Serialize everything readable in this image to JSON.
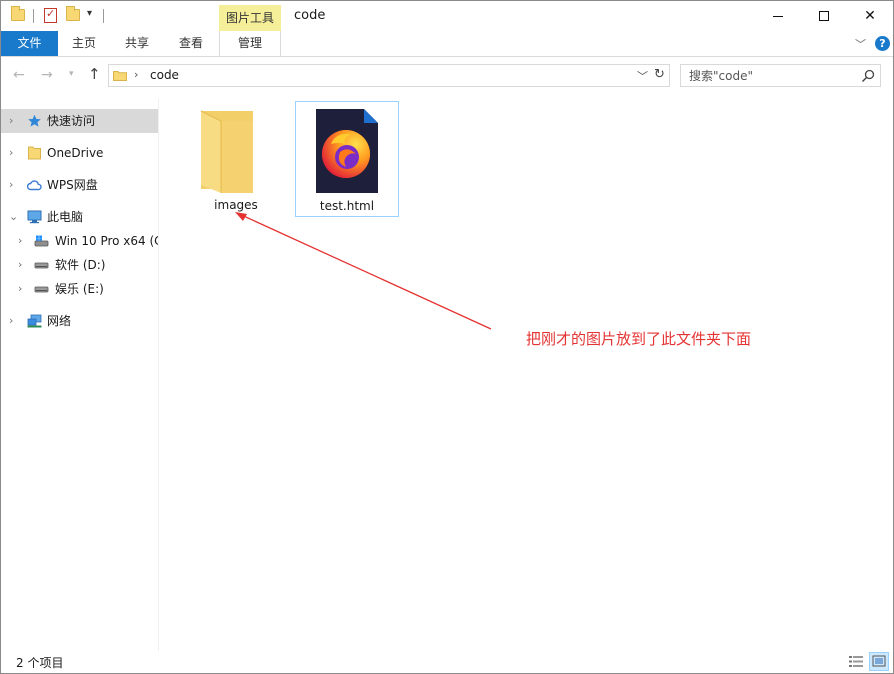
{
  "window": {
    "title": "code",
    "context_tab": "图片工具"
  },
  "ribbon": {
    "tabs": [
      "文件",
      "主页",
      "共享",
      "查看",
      "管理"
    ],
    "file_color": "#1979ca",
    "context_color": "#f6ef9a"
  },
  "nav": {
    "path_segment": "code",
    "search_placeholder": "搜索\"code\""
  },
  "sidebar": {
    "items": [
      {
        "label": "快速访问",
        "icon": "star-icon"
      },
      {
        "label": "OneDrive",
        "icon": "folder-icon"
      },
      {
        "label": "WPS网盘",
        "icon": "cloud-icon"
      },
      {
        "label": "此电脑",
        "icon": "computer-icon"
      },
      {
        "label": "Win 10 Pro x64 (C",
        "icon": "system-drive-icon"
      },
      {
        "label": "软件 (D:)",
        "icon": "drive-icon"
      },
      {
        "label": "娱乐 (E:)",
        "icon": "drive-icon"
      },
      {
        "label": "网络",
        "icon": "network-icon"
      }
    ]
  },
  "files": [
    {
      "name": "images",
      "icon": "folder-icon"
    },
    {
      "name": "test.html",
      "icon": "firefox-html-icon"
    }
  ],
  "annotation": {
    "text": "把刚才的图片放到了此文件夹下面",
    "color": "#e53333"
  },
  "status": {
    "item_count": "2 个项目"
  }
}
